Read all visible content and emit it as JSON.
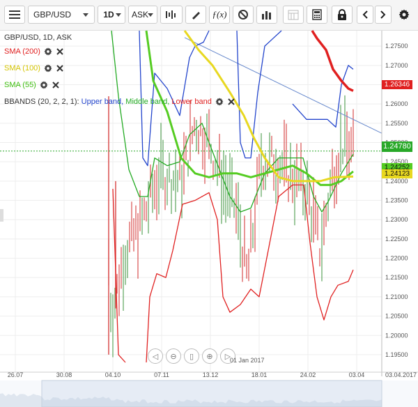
{
  "toolbar": {
    "symbol": "GBP/USD",
    "timeframe": "1D",
    "price_type": "ASK",
    "icons": [
      "menu-icon",
      "symbol-dropdown-icon",
      "timeframe-dropdown-icon",
      "price-type-dropdown-icon",
      "chart-type-icon",
      "draw-icon",
      "function-icon",
      "no-draw-icon",
      "volume-bars-icon",
      "calendar-icon",
      "calculator-icon",
      "lock-icon",
      "prev-icon",
      "next-icon",
      "settings-icon"
    ]
  },
  "legend": {
    "header": "GBP/USD, 1D, ASK",
    "sma200": "SMA (200)",
    "sma100": "SMA (100)",
    "sma55": "SMA (55)",
    "bbands_name": "BBANDS (20, 2, 2, 1):",
    "bb_upper": "Upper band,",
    "bb_middle": "Middle band,",
    "bb_lower": "Lower band"
  },
  "price_tags": {
    "sma200": "1.26346",
    "last": "1.24780",
    "sma55": "1.24252",
    "sma100": "1.24123"
  },
  "x_axis": {
    "labels": [
      "26.07",
      "30.08",
      "04.10",
      "07.11",
      "13.12",
      "18.01",
      "24.02",
      "03.04"
    ],
    "edge_label": "03.04.2017",
    "cursor_label": "01 Jan 2017"
  },
  "y_axis": {
    "labels": [
      "1.27500",
      "1.27000",
      "1.26500",
      "1.26000",
      "1.25500",
      "1.25000",
      "1.24500",
      "1.24000",
      "1.23500",
      "1.23000",
      "1.22500",
      "1.22000",
      "1.21500",
      "1.21000",
      "1.20500",
      "1.20000",
      "1.19500"
    ]
  },
  "colors": {
    "sma200": "#e02020",
    "sma100": "#e8d820",
    "sma55": "#55cc22",
    "upper": "#2244cc",
    "middle": "#22aa22",
    "lower": "#e02020",
    "last": "#28a828",
    "trendline": "#6688cc"
  },
  "chart_data": [
    {
      "type": "line",
      "symbol": "GBP/USD",
      "x": [
        "26.07",
        "30.08",
        "04.10",
        "07.11",
        "13.12",
        "18.01",
        "24.02",
        "03.04"
      ],
      "ylim": [
        1.193,
        1.279
      ],
      "series": [
        {
          "name": "SMA (200)",
          "values": [
            null,
            null,
            null,
            null,
            null,
            1.281,
            1.272,
            1.2634
          ]
        },
        {
          "name": "SMA (100)",
          "values": [
            null,
            null,
            null,
            1.285,
            1.27,
            1.246,
            1.24,
            1.2412
          ]
        },
        {
          "name": "SMA (55)",
          "values": [
            null,
            null,
            null,
            1.248,
            1.242,
            1.242,
            1.24,
            1.2425
          ]
        },
        {
          "name": "Upper band",
          "values": [
            null,
            null,
            null,
            1.264,
            1.278,
            1.276,
            1.258,
            1.269
          ]
        },
        {
          "name": "Middle band",
          "values": [
            null,
            null,
            1.238,
            1.25,
            1.249,
            1.242,
            1.238,
            1.246
          ]
        },
        {
          "name": "Lower band",
          "values": [
            null,
            null,
            1.19,
            1.224,
            1.236,
            1.208,
            1.21,
            1.217
          ]
        }
      ],
      "last_price": 1.2478
    }
  ]
}
